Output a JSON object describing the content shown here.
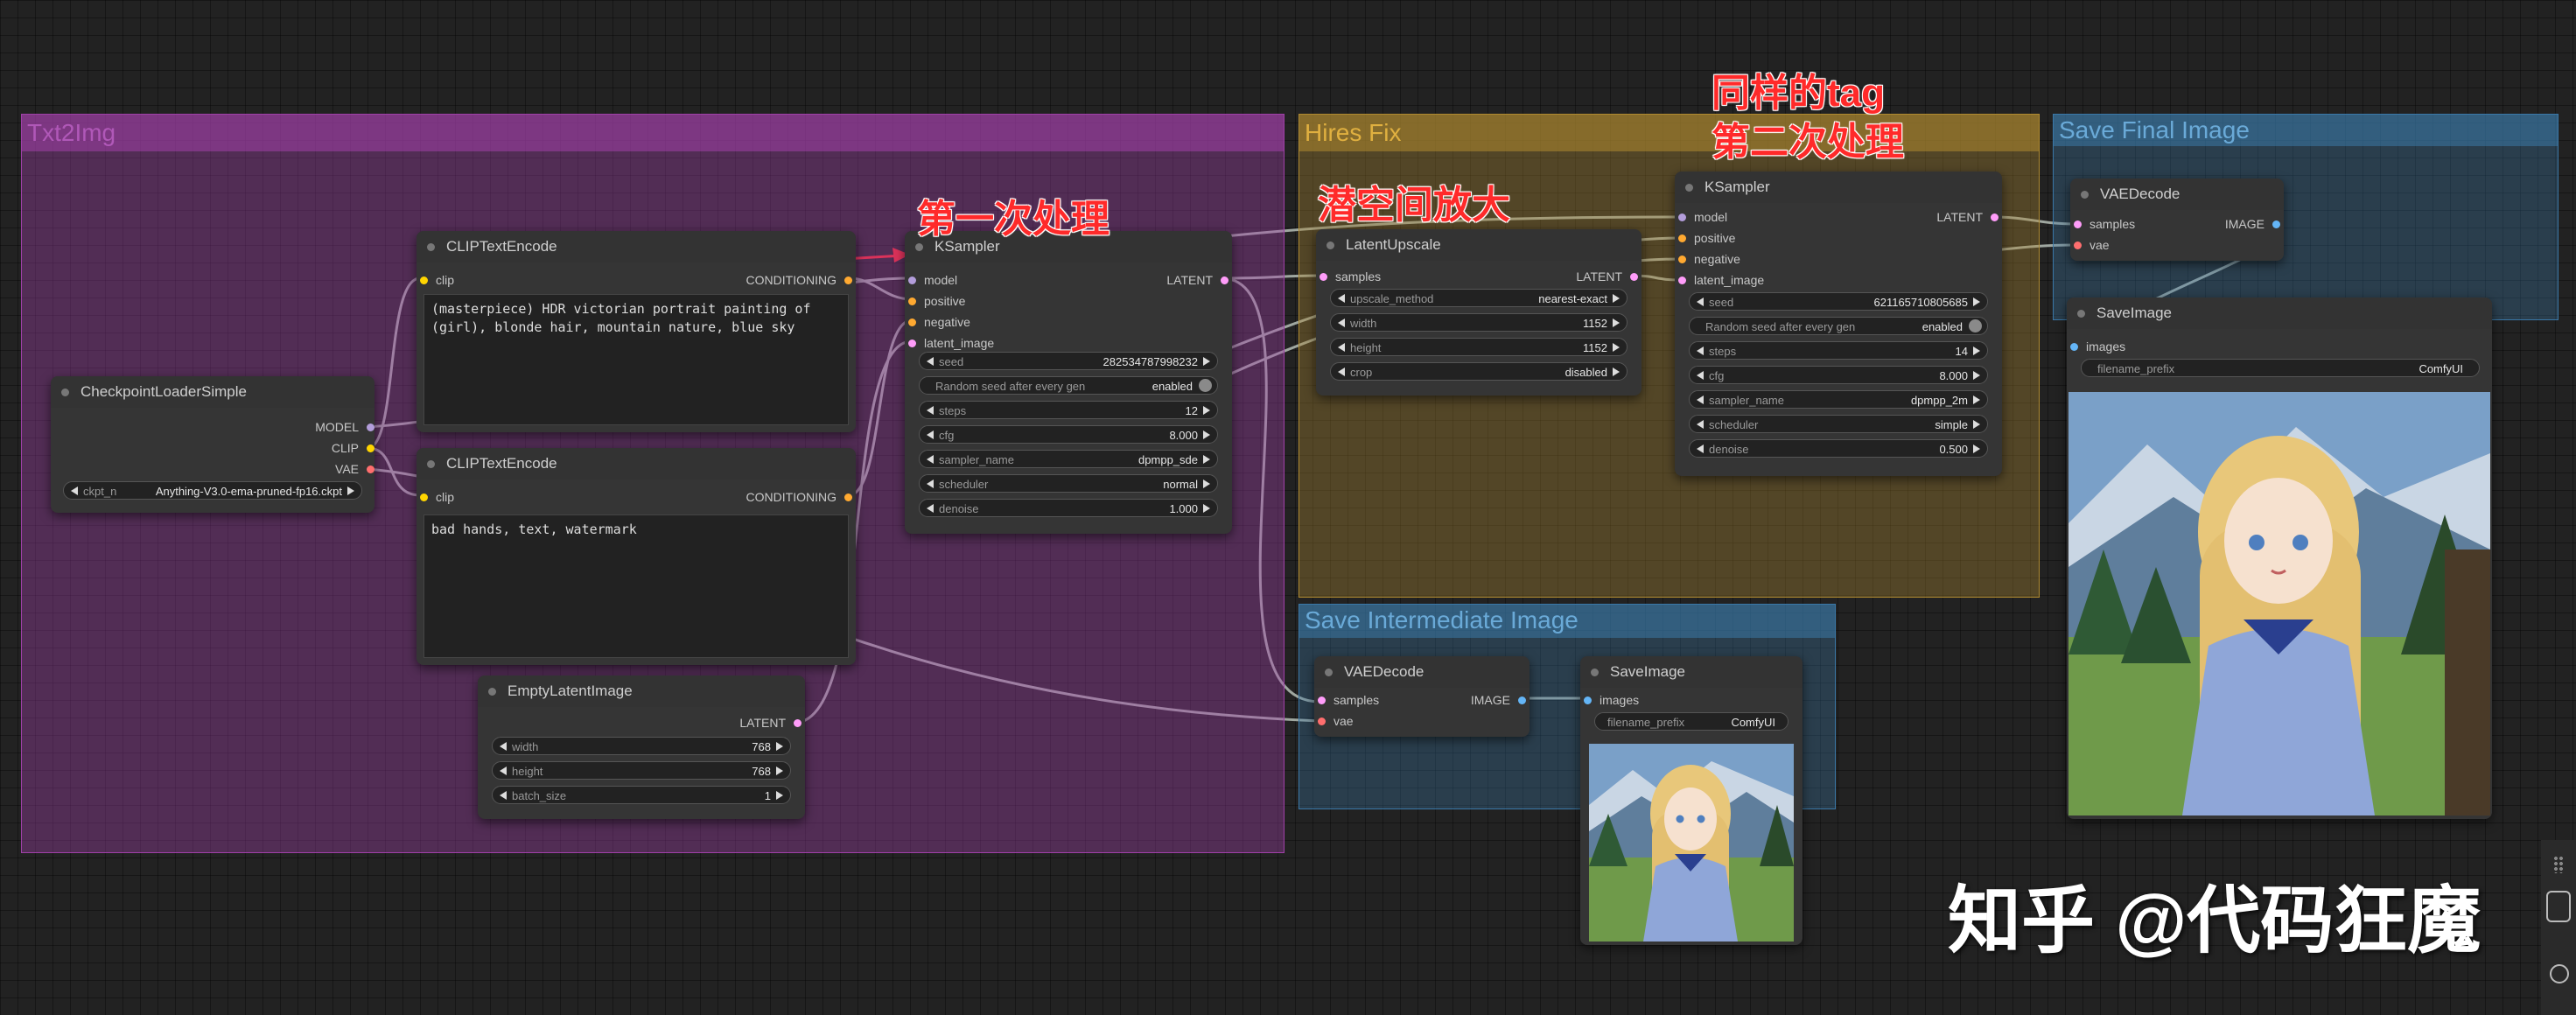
{
  "colors": {
    "model": "#b39ddb",
    "clip": "#ffd500",
    "vae": "#ff6e6e",
    "conditioning": "#ffa931",
    "latent": "#ff9cf9",
    "image": "#64b5f6"
  },
  "groups": [
    {
      "title": "Txt2Img",
      "color": "#a040a8"
    },
    {
      "title": "Hires Fix",
      "color": "#b08a30"
    },
    {
      "title": "Save Final Image",
      "color": "#3a78a8"
    },
    {
      "title": "Save Intermediate Image",
      "color": "#3a78a8"
    }
  ],
  "annotations": {
    "first_pass": "第一次处理",
    "latent_upscale": "潜空间放大",
    "same_tag": "同样的tag",
    "second_pass": "第二次处理"
  },
  "watermark": "知乎 @代码狂魔",
  "nodes": {
    "checkpoint": {
      "title": "CheckpointLoaderSimple",
      "outputs": {
        "model": "MODEL",
        "clip": "CLIP",
        "vae": "VAE"
      },
      "ckpt_label": "ckpt_n",
      "ckpt_value": "Anything-V3.0-ema-pruned-fp16.ckpt"
    },
    "clip_pos": {
      "title": "CLIPTextEncode",
      "input": "clip",
      "output": "CONDITIONING",
      "text": "(masterpiece) HDR victorian portrait painting of (girl), blonde hair, mountain nature, blue sky"
    },
    "clip_neg": {
      "title": "CLIPTextEncode",
      "input": "clip",
      "output": "CONDITIONING",
      "text": "bad hands, text, watermark"
    },
    "empty_latent": {
      "title": "EmptyLatentImage",
      "output": "LATENT",
      "widgets": [
        {
          "label": "width",
          "value": "768"
        },
        {
          "label": "height",
          "value": "768"
        },
        {
          "label": "batch_size",
          "value": "1"
        }
      ]
    },
    "ksampler1": {
      "title": "KSampler",
      "inputs": [
        "model",
        "positive",
        "negative",
        "latent_image"
      ],
      "output": "LATENT",
      "seed": {
        "label": "seed",
        "value": "282534787998232"
      },
      "toggle": {
        "label": "Random seed after every gen",
        "value": "enabled"
      },
      "widgets": [
        {
          "label": "steps",
          "value": "12"
        },
        {
          "label": "cfg",
          "value": "8.000"
        },
        {
          "label": "sampler_name",
          "value": "dpmpp_sde"
        },
        {
          "label": "scheduler",
          "value": "normal"
        },
        {
          "label": "denoise",
          "value": "1.000"
        }
      ]
    },
    "latent_upscale": {
      "title": "LatentUpscale",
      "input": "samples",
      "output": "LATENT",
      "widgets": [
        {
          "label": "upscale_method",
          "value": "nearest-exact"
        },
        {
          "label": "width",
          "value": "1152"
        },
        {
          "label": "height",
          "value": "1152"
        },
        {
          "label": "crop",
          "value": "disabled"
        }
      ]
    },
    "ksampler2": {
      "title": "KSampler",
      "inputs": [
        "model",
        "positive",
        "negative",
        "latent_image"
      ],
      "output": "LATENT",
      "seed": {
        "label": "seed",
        "value": "621165710805685"
      },
      "toggle": {
        "label": "Random seed after every gen",
        "value": "enabled"
      },
      "widgets": [
        {
          "label": "steps",
          "value": "14"
        },
        {
          "label": "cfg",
          "value": "8.000"
        },
        {
          "label": "sampler_name",
          "value": "dpmpp_2m"
        },
        {
          "label": "scheduler",
          "value": "simple"
        },
        {
          "label": "denoise",
          "value": "0.500"
        }
      ]
    },
    "vae_decode_final": {
      "title": "VAEDecode",
      "inputs": [
        "samples",
        "vae"
      ],
      "output": "IMAGE"
    },
    "save_final": {
      "title": "SaveImage",
      "input": "images",
      "prefix_label": "filename_prefix",
      "prefix_value": "ComfyUI"
    },
    "vae_decode_inter": {
      "title": "VAEDecode",
      "inputs": [
        "samples",
        "vae"
      ],
      "output": "IMAGE"
    },
    "save_inter": {
      "title": "SaveImage",
      "input": "images",
      "prefix_label": "filename_prefix",
      "prefix_value": "ComfyUI"
    }
  }
}
